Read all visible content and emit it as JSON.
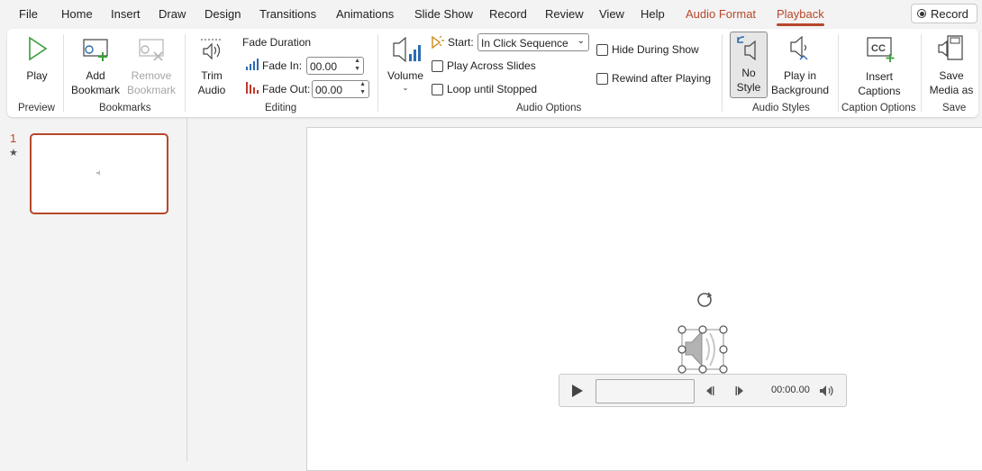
{
  "menu": {
    "tabs": [
      {
        "label": "File"
      },
      {
        "label": "Home"
      },
      {
        "label": "Insert"
      },
      {
        "label": "Draw"
      },
      {
        "label": "Design"
      },
      {
        "label": "Transitions"
      },
      {
        "label": "Animations"
      },
      {
        "label": "Slide Show"
      },
      {
        "label": "Record"
      },
      {
        "label": "Review"
      },
      {
        "label": "View"
      },
      {
        "label": "Help"
      },
      {
        "label": "Audio Format"
      },
      {
        "label": "Playback"
      }
    ],
    "active_tab": "Playback",
    "record_button": "Record"
  },
  "ribbon": {
    "preview": {
      "play": "Play",
      "group": "Preview"
    },
    "bookmarks": {
      "add": [
        "Add",
        "Bookmark"
      ],
      "remove": [
        "Remove",
        "Bookmark"
      ],
      "group": "Bookmarks"
    },
    "editing": {
      "trim": [
        "Trim",
        "Audio"
      ],
      "fade_duration": "Fade Duration",
      "fade_in_label": "Fade In:",
      "fade_in_value": "00.00",
      "fade_out_label": "Fade Out:",
      "fade_out_value": "00.00",
      "group": "Editing"
    },
    "audio_options": {
      "volume": "Volume",
      "start_label": "Start:",
      "start_value": "In Click Sequence",
      "play_across": "Play Across Slides",
      "loop": "Loop until Stopped",
      "hide": "Hide During Show",
      "rewind": "Rewind after Playing",
      "group": "Audio Options"
    },
    "audio_styles": {
      "no_style": [
        "No",
        "Style"
      ],
      "play_bg": [
        "Play in",
        "Background"
      ],
      "group": "Audio Styles"
    },
    "caption_options": {
      "insert": [
        "Insert",
        "Captions"
      ],
      "group": "Caption Options"
    },
    "save": {
      "save_media": [
        "Save",
        "Media as"
      ],
      "group": "Save"
    }
  },
  "slides_pane": {
    "slide_number": "1",
    "star": "★"
  },
  "player": {
    "time": "00:00.00"
  },
  "colors": {
    "accent": "#b7472a",
    "ribbon_bg": "#ffffff",
    "app_bg": "#f3f3f3",
    "icon_blue": "#2b6cb0",
    "icon_green": "#3a9d3a"
  }
}
